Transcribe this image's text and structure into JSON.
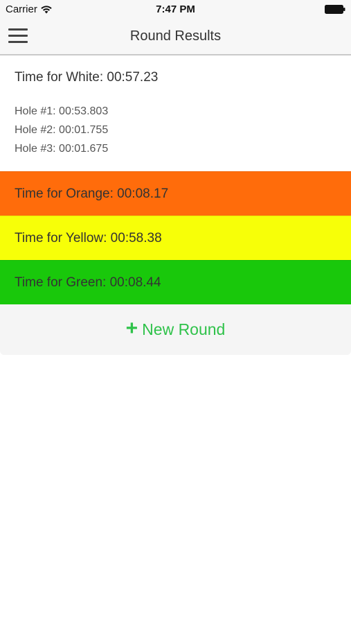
{
  "status_bar": {
    "carrier": "Carrier",
    "time": "7:47 PM"
  },
  "nav": {
    "title": "Round Results",
    "menu_icon": "hamburger-menu-icon"
  },
  "white": {
    "title": "Time for White: 00:57.23",
    "holes": [
      "Hole #1: 00:53.803",
      "Hole #2: 00:01.755",
      "Hole #3: 00:01.675"
    ]
  },
  "rows": [
    {
      "label": "Time for Orange: 00:08.17",
      "color": "#ff6c0b"
    },
    {
      "label": "Time for Yellow: 00:58.38",
      "color": "#f7ff08"
    },
    {
      "label": "Time for Green: 00:08.44",
      "color": "#19c80b"
    }
  ],
  "new_round": {
    "icon": "plus-icon",
    "plus_glyph": "+",
    "label": "New Round",
    "color": "#2fc24a"
  }
}
